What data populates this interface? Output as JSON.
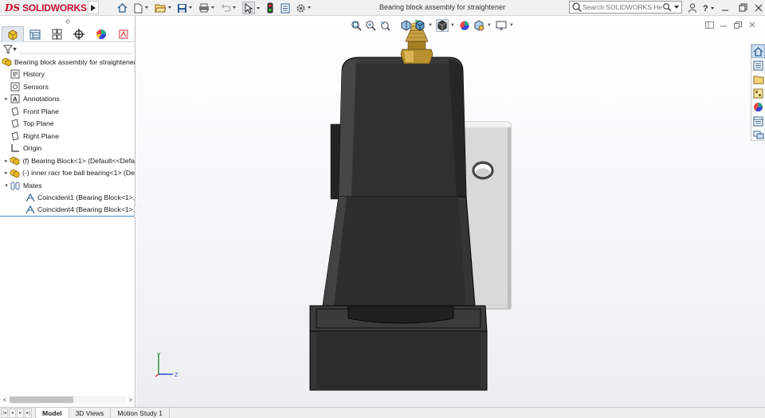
{
  "app": {
    "logo_ds": "DS",
    "logo_name": "SOLIDWORKS",
    "document_title": "Bearing block assembly for straightener"
  },
  "search": {
    "placeholder": "Search SOLIDWORKS Help"
  },
  "quick_access": [
    {
      "icon": "home-icon"
    },
    {
      "icon": "new-document-icon"
    },
    {
      "icon": "open-folder-icon"
    },
    {
      "icon": "save-icon"
    },
    {
      "icon": "print-icon"
    },
    {
      "icon": "undo-icon"
    },
    {
      "icon": "select-arrow-icon"
    },
    {
      "icon": "rebuild-traffic-light-icon"
    },
    {
      "icon": "file-properties-icon"
    },
    {
      "icon": "options-gear-icon"
    }
  ],
  "fm_tabs": [
    {
      "icon": "feature-manager-icon"
    },
    {
      "icon": "property-manager-icon"
    },
    {
      "icon": "configuration-manager-icon"
    },
    {
      "icon": "dimxpert-icon"
    },
    {
      "icon": "display-manager-icon"
    },
    {
      "icon": "cam-icon"
    }
  ],
  "tree": [
    {
      "label": "Bearing block assembly for straightener",
      "icon": "assembly-icon",
      "expander": "",
      "indent": 0
    },
    {
      "label": "History",
      "icon": "history-icon",
      "expander": "",
      "indent": 1
    },
    {
      "label": "Sensors",
      "icon": "sensors-icon",
      "expander": "",
      "indent": 1
    },
    {
      "label": "Annotations",
      "icon": "annotations-icon",
      "expander": "▸",
      "indent": 1
    },
    {
      "label": "Front Plane",
      "icon": "plane-icon",
      "expander": "",
      "indent": 1
    },
    {
      "label": "Top Plane",
      "icon": "plane-icon",
      "expander": "",
      "indent": 1
    },
    {
      "label": "Right Plane",
      "icon": "plane-icon",
      "expander": "",
      "indent": 1
    },
    {
      "label": "Origin",
      "icon": "origin-icon",
      "expander": "",
      "indent": 1
    },
    {
      "label": "(f) Bearing Block<1> (Default<<Defa",
      "icon": "part-icon",
      "expander": "▸",
      "indent": 1
    },
    {
      "label": "(-) inner racr foe ball bearing<1> (De",
      "icon": "part-icon",
      "expander": "▸",
      "indent": 1
    },
    {
      "label": "Mates",
      "icon": "mates-icon",
      "expander": "▾",
      "indent": 1
    },
    {
      "label": "Coincident1 (Bearing Block<1>,",
      "icon": "coincident-mate-icon",
      "expander": "",
      "indent": 2
    },
    {
      "label": "Coincident4 (Bearing Block<1>,",
      "icon": "coincident-mate-icon",
      "expander": "",
      "indent": 2
    }
  ],
  "bottom_tabs": [
    {
      "label": "Model",
      "active": true
    },
    {
      "label": "3D Views",
      "active": false
    },
    {
      "label": "Motion Study 1",
      "active": false
    }
  ],
  "heads_up_toolbar": [
    {
      "icon": "zoom-to-fit-icon"
    },
    {
      "icon": "zoom-to-area-icon"
    },
    {
      "icon": "previous-view-icon"
    },
    {
      "icon": "section-view-icon"
    },
    {
      "icon": "dynamic-annotation-icon"
    },
    {
      "icon": "view-orientation-icon"
    },
    {
      "icon": "display-style-icon"
    },
    {
      "icon": "hide-show-items-icon"
    },
    {
      "icon": "edit-appearance-icon"
    },
    {
      "icon": "apply-scene-icon"
    },
    {
      "icon": "view-settings-icon"
    }
  ],
  "task_pane": [
    {
      "icon": "solidworks-resources-icon"
    },
    {
      "icon": "design-library-icon"
    },
    {
      "icon": "file-explorer-icon"
    },
    {
      "icon": "view-palette-icon"
    },
    {
      "icon": "appearances-scenes-icon"
    },
    {
      "icon": "custom-properties-icon"
    },
    {
      "icon": "forum-icon"
    }
  ],
  "triad": {
    "y_label": "Y",
    "z_label": "Z"
  },
  "colors": {
    "brand_red": "#c8102e",
    "model_black": "#2a2a2a",
    "housing_gray": "#d9d9d9",
    "brass": "#b8902f",
    "accent_blue": "#3b8fd0"
  }
}
